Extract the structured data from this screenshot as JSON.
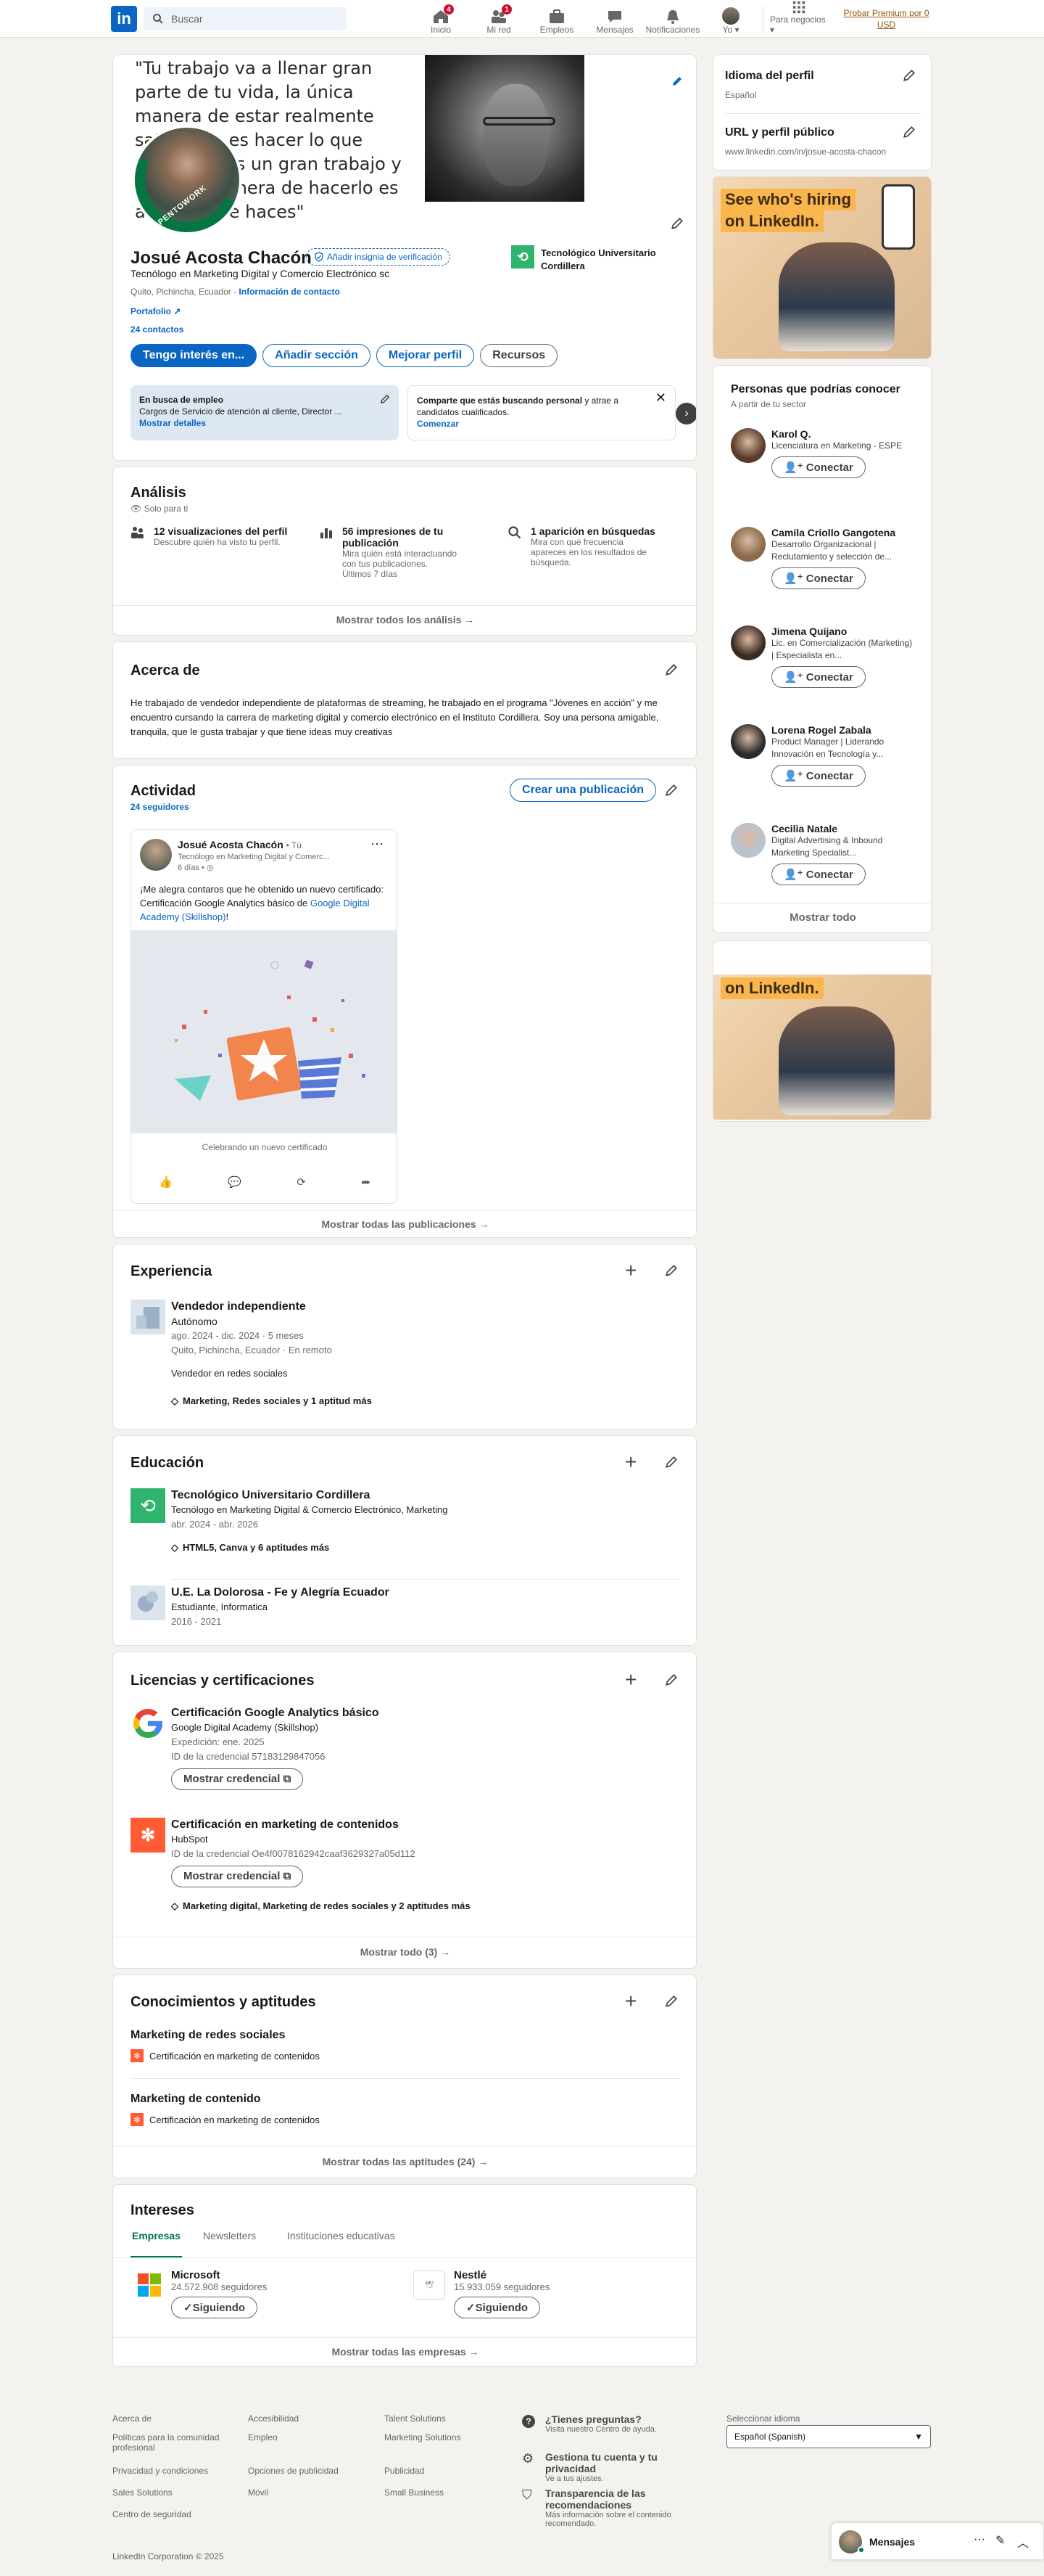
{
  "nav": {
    "search_placeholder": "Buscar",
    "items": [
      {
        "label": "Inicio",
        "badge": "4"
      },
      {
        "label": "Mi red",
        "badge": "1"
      },
      {
        "label": "Empleos"
      },
      {
        "label": "Mensajes"
      },
      {
        "label": "Notificaciones"
      },
      {
        "label": "Yo"
      },
      {
        "label": "Para negocios"
      }
    ],
    "premium_line1": "Probar Premium por 0",
    "premium_line2": "USD"
  },
  "banner": {
    "quote": "\"Tu trabajo va a llenar gran parte de tu vida, la única manera de estar realmente satisfecho es hacer lo que creas que es un gran trabajo y la única manera de hacerlo es amar lo que haces\"",
    "opentowork": "#OPENTOWORK"
  },
  "profile": {
    "name": "Josué Acosta Chacón",
    "verify_label": "Añadir insignia de verificación",
    "headline": "Tecnólogo en Marketing Digital y Comercio Electrónico sc",
    "location": "Quito, Pichincha, Ecuador",
    "contact_info": "Información de contacto",
    "portfolio": "Portafolio",
    "connections": "24 contactos",
    "school": "Tecnológico Universitario Cordillera",
    "buttons": {
      "interested": "Tengo interés en...",
      "add_section": "Añadir sección",
      "improve": "Mejorar perfil",
      "resources": "Recursos"
    },
    "job_seeking": {
      "title": "En busca de empleo",
      "detail": "Cargos de Servicio de atención al cliente, Director ...",
      "show": "Mostrar detalles"
    },
    "share_card": {
      "text_bold": "Comparte que estás buscando personal",
      "text_rest": " y atrae a candidatos cualificados.",
      "link": "Comenzar"
    }
  },
  "analytics": {
    "title": "Análisis",
    "private": "Solo para ti",
    "items": [
      {
        "title": "12 visualizaciones del perfil",
        "desc": "Descubre quién ha visto tu perfil."
      },
      {
        "title": "56 impresiones de tu publicación",
        "desc": "Mira quién está interactuando con tus publicaciones.",
        "sub": "Últimos 7 días"
      },
      {
        "title": "1 aparición en búsquedas",
        "desc": "Mira con qué frecuencia apareces en los resultados de búsqueda."
      }
    ],
    "show_all": "Mostrar todos los análisis →"
  },
  "about": {
    "title": "Acerca de",
    "text": "He trabajado de vendedor independiente de plataformas de streaming, he trabajado en el programa \"Jóvenes en acción\" y me encuentro cursando la carrera de marketing digital y comercio electrónico en el Instituto Cordillera. Soy una persona amigable, tranquila, que le gusta trabajar y que tiene ideas muy creativas"
  },
  "activity": {
    "title": "Actividad",
    "followers": "24 seguidores",
    "create_post": "Crear una publicación",
    "post": {
      "author": "Josué Acosta Chacón",
      "you": "• Tú",
      "headline": "Tecnólogo en Marketing Digital y Comerc...",
      "time": "6 días •",
      "text_before": "¡Me alegra contaros que he obtenido un nuevo certificado: Certificación Google Analytics básico de ",
      "text_link": "Google Digital Academy (Skillshop)",
      "text_after": "!",
      "caption": "Celebrando un nuevo certificado"
    },
    "show_all": "Mostrar todas las publicaciones →"
  },
  "experience": {
    "title": "Experiencia",
    "items": [
      {
        "role": "Vendedor independiente",
        "org": "Autónomo",
        "dates": "ago. 2024 - dic. 2024 · 5 meses",
        "place": "Quito, Pichincha, Ecuador · En remoto",
        "desc": "Vendedor en redes sociales",
        "skills": "Marketing, Redes sociales y 1 aptitud más"
      }
    ]
  },
  "education": {
    "title": "Educación",
    "items": [
      {
        "school": "Tecnológico Universitario Cordillera",
        "degree": "Tecnólogo en Marketing Digital & Comercio Electrónico, Marketing",
        "dates": "abr. 2024 - abr. 2026",
        "skills": "HTML5, Canva y 6 aptitudes más"
      },
      {
        "school": "U.E. La Dolorosa - Fe y Alegría Ecuador",
        "degree": "Estudiante, Informatica",
        "dates": "2016 - 2021"
      }
    ]
  },
  "licenses": {
    "title": "Licencias y certificaciones",
    "items": [
      {
        "name": "Certificación Google Analytics básico",
        "issuer": "Google Digital Academy (Skillshop)",
        "issued": "Expedición: ene. 2025",
        "cred_id": "ID de la credencial 57183129847056",
        "button": "Mostrar credencial"
      },
      {
        "name": "Certificación en marketing de contenidos",
        "issuer": "HubSpot",
        "cred_id": "ID de la credencial Oe4f0078162942caaf3629327a05d112",
        "button": "Mostrar credencial",
        "skills": "Marketing digital, Marketing de redes sociales y 2 aptitudes más"
      }
    ],
    "show_all": "Mostrar todo (3) →"
  },
  "skills": {
    "title": "Conocimientos y aptitudes",
    "items": [
      {
        "name": "Marketing de redes sociales",
        "cert": "Certificación en marketing de contenidos"
      },
      {
        "name": "Marketing de contenido",
        "cert": "Certificación en marketing de contenidos"
      }
    ],
    "show_all": "Mostrar todas las aptitudes (24) →"
  },
  "interests": {
    "title": "Intereses",
    "tabs": [
      "Empresas",
      "Newsletters",
      "Instituciones educativas"
    ],
    "items": [
      {
        "name": "Microsoft",
        "followers": "24.572.908 seguidores",
        "button": "Siguiendo"
      },
      {
        "name": "Nestlé",
        "followers": "15.933.059 seguidores",
        "button": "Siguiendo"
      }
    ],
    "show_all": "Mostrar todas las empresas →"
  },
  "sidebar": {
    "lang_title": "Idioma del perfil",
    "lang_value": "Español",
    "url_title": "URL y perfil público",
    "url_value": "www.linkedin.com/in/josue-acosta-chacon",
    "ad_line1": "See who's hiring",
    "ad_line2": "on LinkedIn.",
    "people_title": "Personas que podrías conocer",
    "people_sub": "A partir de tu sector",
    "connect": "Conectar",
    "people": [
      {
        "name": "Karol Q.",
        "headline": "Licenciatura en Marketing - ESPE"
      },
      {
        "name": "Camila Criollo Gangotena",
        "headline": "Desarrollo Organizacional | Reclutamiento y selección de..."
      },
      {
        "name": "Jimena Quijano",
        "headline": "Lic. en Comercialización (Marketing) | Especialista en..."
      },
      {
        "name": "Lorena Rogel Zabala",
        "headline": "Product Manager | Liderando Innovación en Tecnología y..."
      },
      {
        "name": "Cecilia Natale",
        "headline": "Digital Advertising & Inbound Marketing Specialist..."
      }
    ],
    "show_all": "Mostrar todo",
    "ad2_line": "on LinkedIn."
  },
  "footer": {
    "col1": [
      "Acerca de",
      "Políticas para la comunidad profesional",
      "Privacidad y condiciones",
      "Sales Solutions",
      "Centro de seguridad"
    ],
    "col2": [
      "Accesibilidad",
      "Empleo",
      "Opciones de publicidad",
      "Móvil"
    ],
    "col3": [
      "Talent Solutions",
      "Marketing Solutions",
      "Publicidad",
      "Small Business"
    ],
    "help": [
      {
        "title": "¿Tienes preguntas?",
        "sub": "Visita nuestro Centro de ayuda."
      },
      {
        "title": "Gestiona tu cuenta y tu privacidad",
        "sub": "Ve a tus ajustes."
      },
      {
        "title": "Transparencia de las recomendaciones",
        "sub": "Más información sobre el contenido recomendado."
      }
    ],
    "lang_label": "Seleccionar idioma",
    "lang_value": "Español (Spanish)",
    "copyright": "LinkedIn Corporation © 2025"
  },
  "messaging": {
    "label": "Mensajes"
  },
  "colors": {
    "brand": "#0a66c2",
    "open_to_work": "#057642",
    "hubspot": "#ff5c35",
    "cordillera": "#2fb46e"
  }
}
